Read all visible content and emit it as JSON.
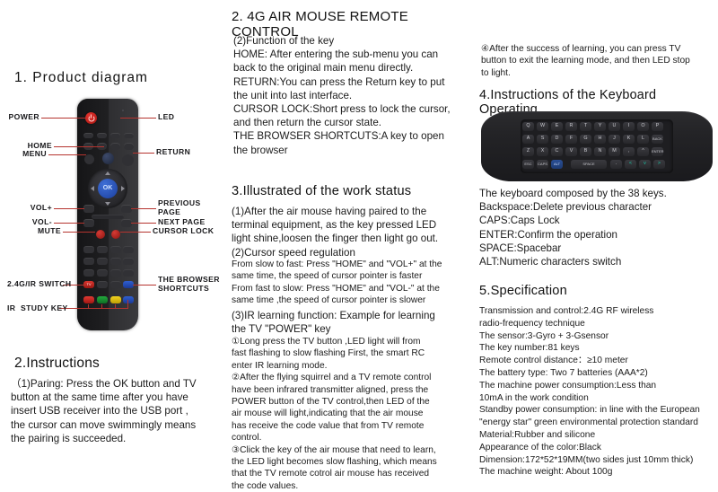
{
  "sections": {
    "product_diagram_title": "1. Product diagram",
    "instructions_title": "2.Instructions",
    "airmouse_title": "2. 4G AIR MOUSE REMOTE CONTROL",
    "workstatus_title": "3.Illustrated of the work status",
    "keyboard_title": "4.Instructions of the Keyboard Operating",
    "spec_title": "5.Specification"
  },
  "remote_labels": {
    "power": "POWER",
    "led": "LED",
    "home": "HOME",
    "menu": "MENU",
    "return": "RETURN",
    "vol_up": "VOL+",
    "vol_down": "VOL-",
    "mute": "MUTE",
    "previous_page": "PREVIOUS\nPAGE",
    "next_page": "NEXT PAGE",
    "cursor_lock": "CURSOR LOCK",
    "switch_24g_ir": "2.4G/IR SWITCH",
    "browser_shortcuts": "THE BROWSER\nSHORTCUTS",
    "ir_study_key": "IR  STUDY KEY",
    "ok": "OK",
    "tv": "TV"
  },
  "instructions_body": "（1)Paring: Press the OK button and TV\nbutton at the same time after you have\n insert USB receiver into the USB port ,\nthe cursor can move swimmingly means\nthe pairing is succeeded.",
  "function_of_key": {
    "heading": " (2)Function of the key",
    "lines": [
      "HOME: After entering the sub-menu you can",
      "back to the original main menu directly.",
      "RETURN:You can press the Return key to put",
      "the unit into last interface.",
      "CURSOR LOCK:Short press to lock the cursor,",
      "and then return the cursor state.",
      "THE BROWSER SHORTCUTS:A key to open",
      "the browser"
    ]
  },
  "work_status": {
    "item1": "(1)After the air mouse having paired to the\nterminal equipment, as the key pressed LED\nlight shine,loosen the finger then light go out.",
    "item2_head": "(2)Cursor speed regulation",
    "item2_body": "From slow to fast: Press \"HOME\" and \"VOL+\" at the\nsame time, the speed of cursor pointer is faster\nFrom fast to slow: Press \"HOME\" and \"VOL-\" at the\nsame time ,the speed of cursor pointer is slower",
    "item3_head": "(3)IR learning function: Example for learning\nthe TV \"POWER\" key",
    "item3_body": "①Long press the TV button ,LED light will from\nfast flashing to slow flashing First, the smart RC\nenter IR learning mode.\n②After the flying squirrel and a TV remote control\n have been infrared transmitter aligned, press the\nPOWER button of the TV control,then LED of the\nair mouse will light,indicating that the air mouse\nhas receive the code value that from TV remote\ncontrol.\n③Click the key of the air mouse that need to learn,\nthe LED light becomes slow flashing, which means\nthat the TV remote cotrol air mouse has received\nthe code values.",
    "item4": "④After the success of learning, you can press TV\nbutton to exit the learning mode, and then LED stop\n to light."
  },
  "keyboard": {
    "photo_keys": {
      "row1": [
        "Q",
        "W",
        "E",
        "R",
        "T",
        "Y",
        "U",
        "I",
        "O",
        "P"
      ],
      "row2": [
        "A",
        "S",
        "D",
        "F",
        "G",
        "H",
        "J",
        "K",
        "L",
        "BACK"
      ],
      "row3": [
        "Z",
        "X",
        "C",
        "V",
        "B",
        "N",
        "M",
        ",",
        "^",
        "ENTER"
      ],
      "row4": [
        "ESC",
        "CAPS",
        "ALT",
        "SPACE",
        ".",
        "<",
        "v",
        ">"
      ]
    },
    "lines": [
      "The keyboard composed by the 38 keys.",
      "Backspace:Delete previous character",
      "CAPS:Caps Lock",
      "ENTER:Confirm the operation",
      "SPACE:Spacebar",
      "ALT:Numeric characters switch"
    ]
  },
  "specification": {
    "lines": [
      "Transmission and control:2.4G RF wireless",
      "radio-frequency technique",
      "The sensor:3-Gyro + 3-Gsensor",
      "The key number:81 keys",
      "Remote control distance：≥10 meter",
      "The battery type: Two 7 batteries (AAA*2)",
      "The machine power consumption:Less than",
      "10mA  in the work condition",
      "Standby power consumption: in line with the European",
      " \"energy star\" green environmental protection standard",
      "Material:Rubber and silicone",
      "Appearance of the color:Black",
      "Dimension:172*52*19MM(two sides just 10mm thick)",
      "The machine weight: About 100g"
    ]
  },
  "colors": {
    "callout": "#b5342f",
    "power_red": "#d4302a",
    "ok_blue": "#2a56c6",
    "ir_red": "#e03a33",
    "ir_green": "#23a83c",
    "ir_yellow": "#f0d21f",
    "ir_blue": "#2f5fd0"
  }
}
